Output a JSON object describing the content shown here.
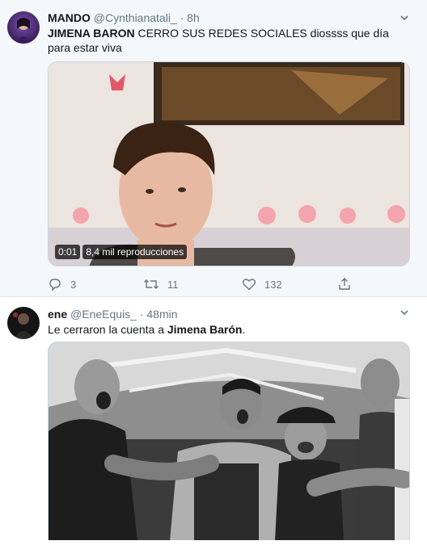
{
  "tweets": [
    {
      "display_name": "MANDO",
      "handle": "@Cynthianatali_",
      "time": " · 8h",
      "text_bold": "JIMENA BARON",
      "text_rest": " CERRO SUS REDES SOCIALES diossss que día para estar viva",
      "video": {
        "time": "0:01",
        "views": "8,4 mil reproducciones"
      },
      "actions": {
        "replies": "3",
        "retweets": "11",
        "likes": "132"
      }
    },
    {
      "display_name": "ene",
      "handle": "@EneEquis_",
      "time": " · 48min",
      "text_plain": "Le cerraron la cuenta a ",
      "text_bold": "Jimena Barón",
      "text_end": "."
    }
  ],
  "icons": {
    "reply": "reply-icon",
    "retweet": "retweet-icon",
    "like": "heart-icon",
    "share": "share-icon",
    "caret": "chevron-down-icon"
  },
  "colors": {
    "secondary_text": "#657786",
    "border": "#e1e8ed",
    "highlight_bg": "#f5f8fa"
  }
}
